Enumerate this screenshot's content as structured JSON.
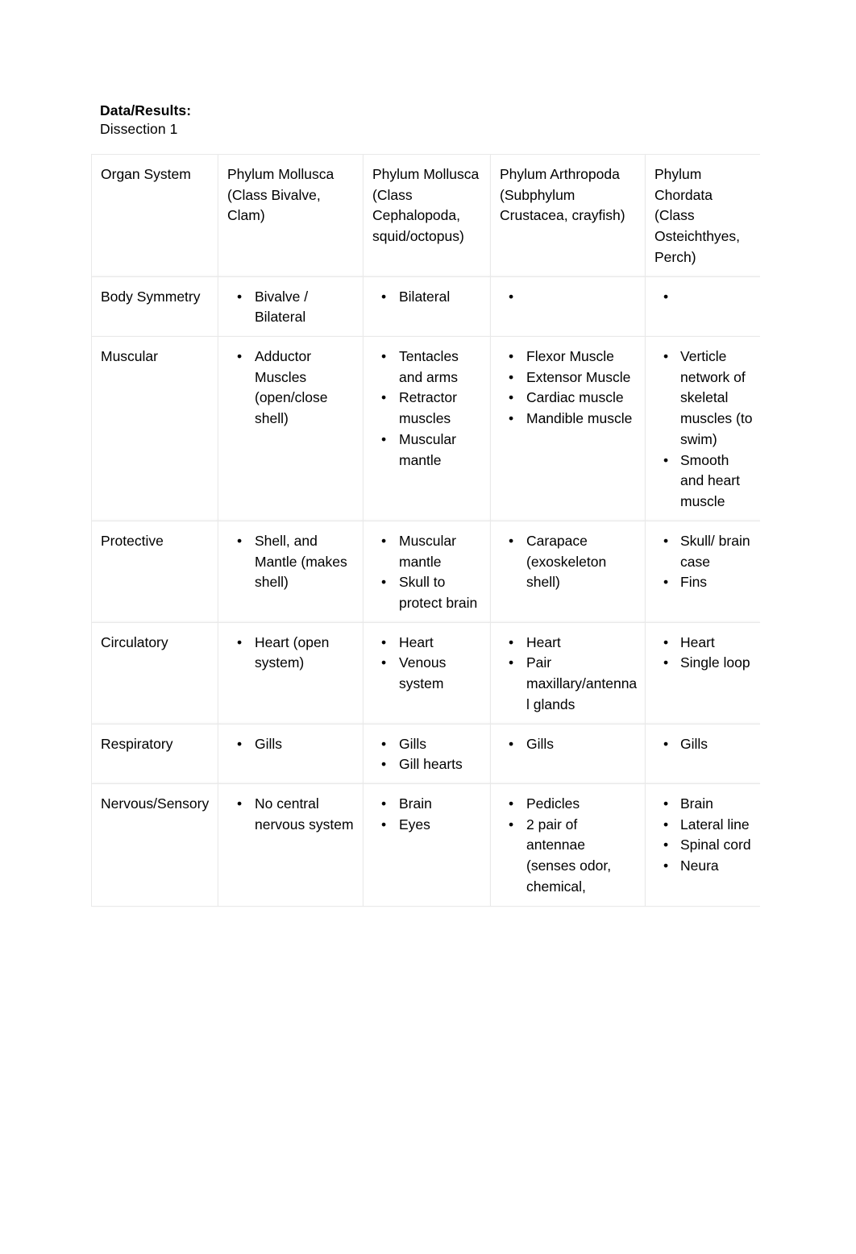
{
  "document": {
    "heading": "Data/Results:",
    "subheading": "Dissection 1"
  },
  "table": {
    "columns": [
      "Organ System",
      "Phylum Mollusca (Class Bivalve, Clam)",
      "Phylum Mollusca (Class Cephalopoda, squid/octopus)",
      "Phylum Arthropoda (Subphylum Crustacea, crayfish)",
      "Phylum Chordata (Class Osteichthyes, Perch)"
    ],
    "rows": [
      {
        "label": "Body Symmetry",
        "bivalve": [
          "Bivalve / Bilateral"
        ],
        "cephalopoda": [
          "Bilateral"
        ],
        "arthropoda": [
          ""
        ],
        "chordata": [
          ""
        ]
      },
      {
        "label": "Muscular",
        "bivalve": [
          "Adductor Muscles (open/close shell)"
        ],
        "cephalopoda": [
          "Tentacles and arms",
          "Retractor muscles",
          "Muscular mantle"
        ],
        "arthropoda": [
          "Flexor Muscle",
          "Extensor Muscle",
          "Cardiac muscle",
          "Mandible muscle"
        ],
        "chordata": [
          "Verticle network of skeletal muscles (to swim)",
          "Smooth and heart muscle"
        ]
      },
      {
        "label": "Protective",
        "bivalve": [
          "Shell, and Mantle (makes shell)"
        ],
        "cephalopoda": [
          "Muscular mantle",
          "Skull to protect brain"
        ],
        "arthropoda": [
          "Carapace (exoskeleton shell)"
        ],
        "chordata": [
          "Skull/ brain case",
          "Fins"
        ]
      },
      {
        "label": "Circulatory",
        "bivalve": [
          "Heart (open system)"
        ],
        "cephalopoda": [
          "Heart",
          "Venous system"
        ],
        "arthropoda": [
          "Heart",
          "Pair maxillary/antennal glands"
        ],
        "chordata": [
          "Heart",
          "Single loop"
        ]
      },
      {
        "label": "Respiratory",
        "bivalve": [
          "Gills"
        ],
        "cephalopoda": [
          "Gills",
          "Gill hearts"
        ],
        "arthropoda": [
          "Gills"
        ],
        "chordata": [
          "Gills"
        ]
      },
      {
        "label": "Nervous/Sensory",
        "bivalve": [
          "No central nervous system"
        ],
        "cephalopoda": [
          "Brain",
          "Eyes"
        ],
        "arthropoda": [
          "Pedicles",
          "2 pair of antennae (senses odor, chemical,"
        ],
        "chordata": [
          "Brain",
          "Lateral line",
          "Spinal cord",
          "Neura"
        ]
      }
    ]
  },
  "style": {
    "page_background": "#ffffff",
    "text_color": "#000000",
    "border_color": "#e9e9e9"
  }
}
